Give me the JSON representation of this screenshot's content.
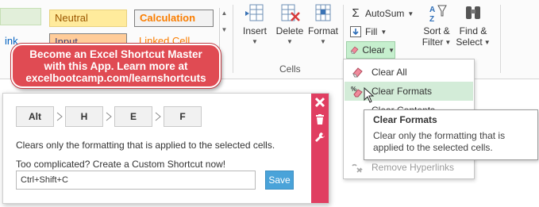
{
  "colors": {
    "accent_pink": "#e03e61",
    "callout_red": "#e04b53",
    "save_blue": "#4aa3d9",
    "highlight_green": "#d3ecd8"
  },
  "cell_styles": {
    "neutral": "Neutral",
    "calculation": "Calculation",
    "link_fragment": "ink",
    "input_fragment": "Input",
    "linked_cell_fragment": "Linked Cell"
  },
  "cells_group": {
    "label": "Cells",
    "insert": "Insert",
    "delete": "Delete",
    "format": "Format"
  },
  "editing_group": {
    "autosum": "AutoSum",
    "fill": "Fill",
    "clear": "Clear",
    "sort_filter_line1": "Sort &",
    "sort_filter_line2": "Filter",
    "find_select_line1": "Find &",
    "find_select_line2": "Select"
  },
  "clear_menu": {
    "items": [
      {
        "label": "Clear All"
      },
      {
        "label": "Clear Formats"
      },
      {
        "label": "Clear Contents"
      },
      {
        "label": "Remove Hyperlinks"
      }
    ]
  },
  "tooltip": {
    "title": "Clear Formats",
    "body": "Clear only the formatting that is applied to the selected cells."
  },
  "callout": {
    "line1": "Become an Excel Shortcut Master",
    "line2": "with this App. Learn more at",
    "line3": "excelbootcamp.com/learnshortcuts"
  },
  "shortcut_panel": {
    "keys": [
      "Alt",
      "H",
      "E",
      "F"
    ],
    "description": "Clears only the formatting that is applied to the selected cells.",
    "prompt": "Too complicated? Create a Custom Shortcut now!",
    "shortcut_value": "Ctrl+Shift+C",
    "save_label": "Save"
  },
  "icons": [
    "insert-icon",
    "delete-icon",
    "format-icon",
    "autosum-icon",
    "fill-icon",
    "eraser-icon",
    "sort-filter-icon",
    "binoculars-icon",
    "close-icon",
    "trash-icon",
    "wrench-icon",
    "cursor-icon"
  ]
}
